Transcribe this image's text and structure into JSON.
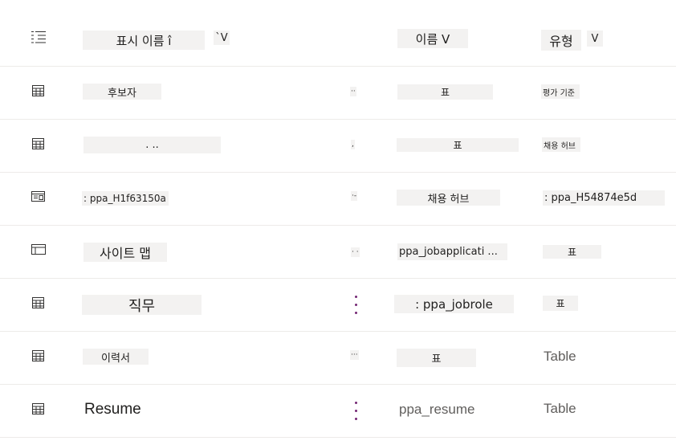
{
  "header": {
    "display_name": "표시 이름 î",
    "display_sort": "`V",
    "name": "이름 V",
    "type": "유형",
    "type_sort": "V"
  },
  "rows": [
    {
      "display": "후보자",
      "menu": "··",
      "name": "표",
      "type": "평가 기준",
      "icon": "table-icon"
    },
    {
      "display": ". ..",
      "menu": ",",
      "name": "표",
      "type": "채용 허브",
      "icon": "table-icon"
    },
    {
      "display": ": ppa_H1f63150a",
      "menu": "·‑",
      "name": "채용 허브",
      "type": ": ppa_H54874e5d",
      "icon": "form-icon"
    },
    {
      "display": "사이트 맵",
      "menu": "· ·",
      "name": "ppa_jobapplicati ...",
      "type": "표",
      "icon": "sitemap-icon"
    },
    {
      "display": "직무",
      "name": ": ppa_jobrole",
      "type": "표",
      "icon": "table-icon"
    },
    {
      "display": "이력서",
      "menu": "···",
      "name": "표",
      "type": "Table",
      "icon": "table-icon"
    },
    {
      "display": "Resume",
      "name": "ppa_resume",
      "type": "Table",
      "icon": "table-icon"
    }
  ]
}
